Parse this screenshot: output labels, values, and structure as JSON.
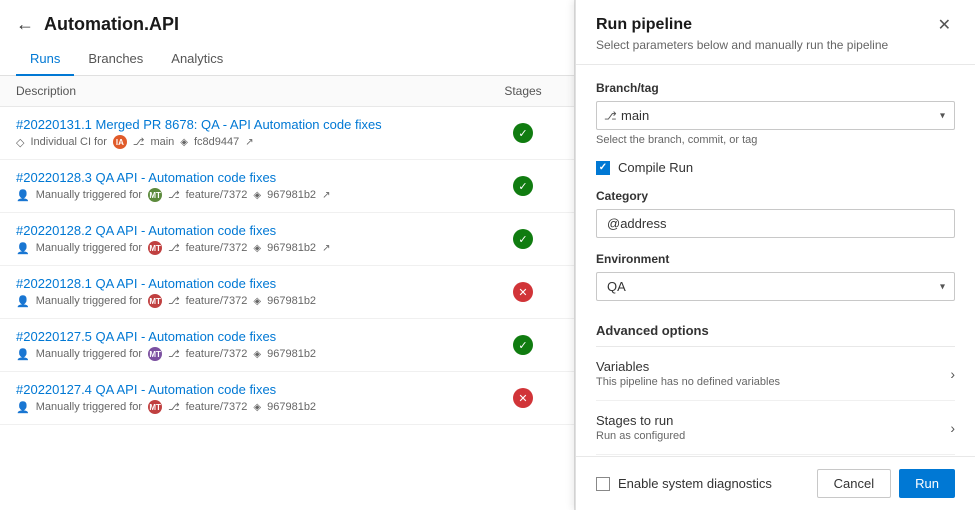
{
  "page": {
    "title": "Automation.API",
    "back_label": "←"
  },
  "tabs": [
    {
      "id": "runs",
      "label": "Runs",
      "active": true
    },
    {
      "id": "branches",
      "label": "Branches",
      "active": false
    },
    {
      "id": "analytics",
      "label": "Analytics",
      "active": false
    }
  ],
  "table_header": {
    "description": "Description",
    "stages": "Stages"
  },
  "runs": [
    {
      "id": "run1",
      "title": "#20220131.1 Merged PR 8678: QA - API Automation code fixes",
      "trigger": "Individual CI for",
      "avatar_color": "#e05b2a",
      "avatar_text": "IA",
      "branch": "main",
      "commit": "fc8d9447",
      "has_link_icon": true,
      "status": "success"
    },
    {
      "id": "run2",
      "title": "#20220128.3 QA API - Automation code fixes",
      "trigger": "Manually triggered for",
      "avatar_color": "#5c8a3c",
      "avatar_text": "MT",
      "branch": "feature/7372",
      "commit": "967981b2",
      "has_link_icon": true,
      "status": "success"
    },
    {
      "id": "run3",
      "title": "#20220128.2 QA API - Automation code fixes",
      "trigger": "Manually triggered for",
      "avatar_color": "#c04040",
      "avatar_text": "MT",
      "branch": "feature/7372",
      "commit": "967981b2",
      "has_link_icon": true,
      "status": "success"
    },
    {
      "id": "run4",
      "title": "#20220128.1 QA API - Automation code fixes",
      "trigger": "Manually triggered for",
      "avatar_color": "#c04040",
      "avatar_text": "MT",
      "branch": "feature/7372",
      "commit": "967981b2",
      "has_link_icon": false,
      "status": "failed"
    },
    {
      "id": "run5",
      "title": "#20220127.5 QA API - Automation code fixes",
      "trigger": "Manually triggered for",
      "avatar_color": "#7b50a0",
      "avatar_text": "MT",
      "branch": "feature/7372",
      "commit": "967981b2",
      "has_link_icon": false,
      "status": "success"
    },
    {
      "id": "run6",
      "title": "#20220127.4 QA API - Automation code fixes",
      "trigger": "Manually triggered for",
      "avatar_color": "#c04040",
      "avatar_text": "MT",
      "branch": "feature/7372",
      "commit": "967981b2",
      "has_link_icon": false,
      "status": "failed"
    }
  ],
  "drawer": {
    "title": "Run pipeline",
    "subtitle": "Select parameters below and manually run the pipeline",
    "branch_tag_label": "Branch/tag",
    "branch_value": "main",
    "branch_hint": "Select the branch, commit, or tag",
    "compile_run_label": "Compile Run",
    "category_label": "Category",
    "category_value": "@address",
    "environment_label": "Environment",
    "environment_value": "QA",
    "advanced_options_title": "Advanced options",
    "variables_title": "Variables",
    "variables_subtitle": "This pipeline has no defined variables",
    "stages_to_run_title": "Stages to run",
    "stages_to_run_subtitle": "Run as configured",
    "enable_diagnostics_label": "Enable system diagnostics",
    "cancel_label": "Cancel",
    "run_label": "Run"
  },
  "colors": {
    "accent": "#0078d4",
    "success": "#107c10",
    "failed": "#d13438"
  }
}
